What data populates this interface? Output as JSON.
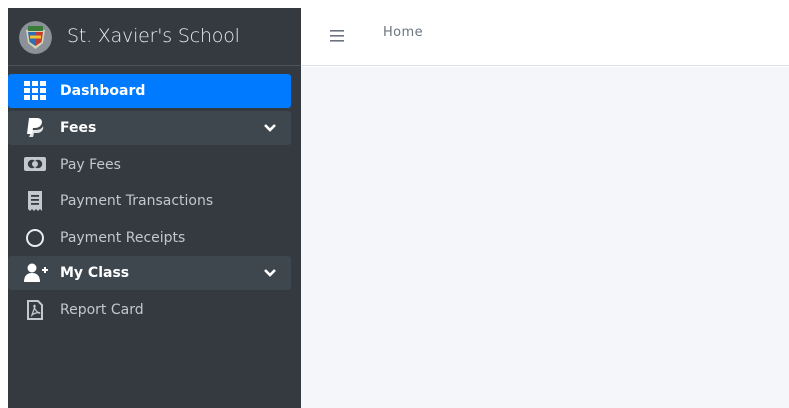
{
  "brand": {
    "name": "St. Xavier's School",
    "logo_icon": "school-crest-logo"
  },
  "sidebar": {
    "items": [
      {
        "label": "Dashboard",
        "icon": "grid-icon",
        "state": "active"
      },
      {
        "label": "Fees",
        "icon": "paypal-icon",
        "state": "group-open"
      },
      {
        "label": "Pay Fees",
        "icon": "money-bill-icon"
      },
      {
        "label": "Payment Transactions",
        "icon": "receipt-icon"
      },
      {
        "label": "Payment Receipts",
        "icon": "circle-icon"
      },
      {
        "label": "My Class",
        "icon": "user-plus-icon",
        "state": "group-open"
      },
      {
        "label": "Report Card",
        "icon": "file-pdf-icon"
      }
    ]
  },
  "header": {
    "menu_icon": "hamburger-icon",
    "breadcrumb": "Home"
  },
  "colors": {
    "sidebar_bg": "#343a40",
    "active": "#007bff",
    "group_bg": "#3f474e",
    "content_bg": "#f4f6f9"
  }
}
